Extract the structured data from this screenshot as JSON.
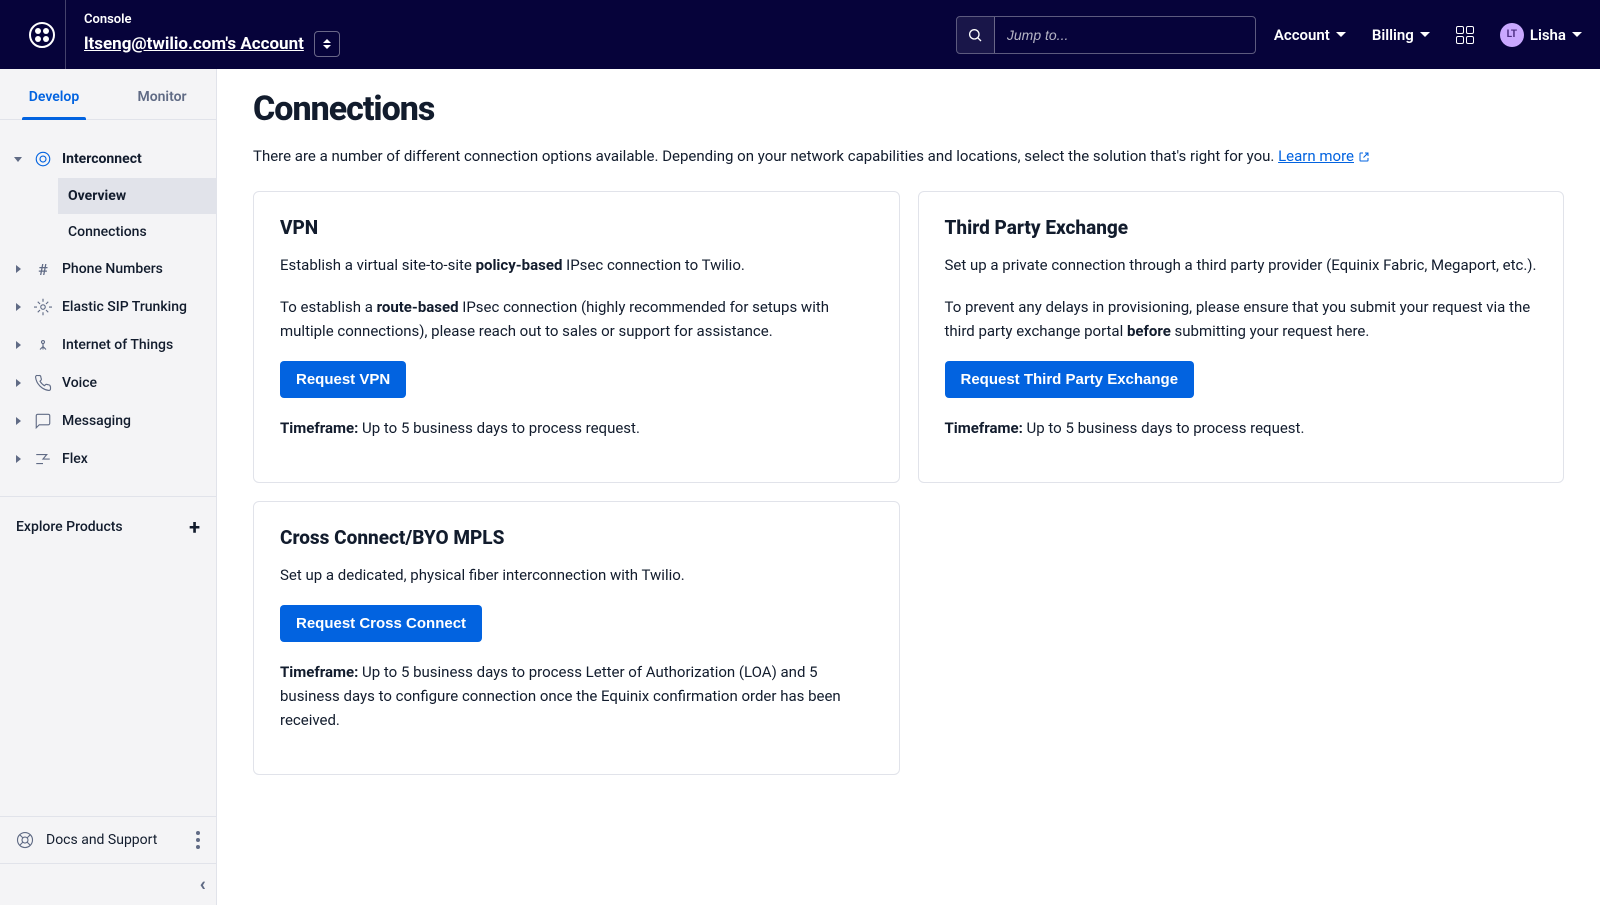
{
  "header": {
    "console_label": "Console",
    "account_name": "ltseng@twilio.com's Account",
    "search_placeholder": "Jump to...",
    "nav": {
      "account": "Account",
      "billing": "Billing",
      "user_initials": "LT",
      "user_name": "Lisha"
    }
  },
  "sidebar": {
    "tabs": {
      "develop": "Develop",
      "monitor": "Monitor"
    },
    "interconnect": {
      "label": "Interconnect",
      "children": {
        "overview": "Overview",
        "connections": "Connections"
      }
    },
    "items": [
      {
        "label": "Phone Numbers"
      },
      {
        "label": "Elastic SIP Trunking"
      },
      {
        "label": "Internet of Things"
      },
      {
        "label": "Voice"
      },
      {
        "label": "Messaging"
      },
      {
        "label": "Flex"
      }
    ],
    "explore": "Explore Products",
    "docs": "Docs and Support"
  },
  "page": {
    "title": "Connections",
    "intro_text": "There are a number of different connection options available. Depending on your network capabilities and locations, select the solution that's right for you. ",
    "learn_more": "Learn more"
  },
  "cards": {
    "vpn": {
      "title": "VPN",
      "p1a": "Establish a virtual site-to-site ",
      "p1b": "policy-based",
      "p1c": " IPsec connection to Twilio.",
      "p2a": "To establish a ",
      "p2b": "route-based",
      "p2c": " IPsec connection (highly recommended for setups with multiple connections), please reach out to sales or support for assistance.",
      "button": "Request VPN",
      "tf_label": "Timeframe:",
      "tf_text": " Up to 5 business days to process request."
    },
    "tpx": {
      "title": "Third Party Exchange",
      "p1": "Set up a private connection through a third party provider (Equinix Fabric, Megaport, etc.).",
      "p2a": "To prevent any delays in provisioning, please ensure that you submit your request via the third party exchange portal ",
      "p2b": "before",
      "p2c": " submitting your request here.",
      "button": "Request Third Party Exchange",
      "tf_label": "Timeframe:",
      "tf_text": " Up to 5 business days to process request."
    },
    "cc": {
      "title": "Cross Connect/BYO MPLS",
      "p1": "Set up a dedicated, physical fiber interconnection with Twilio.",
      "button": "Request Cross Connect",
      "tf_label": "Timeframe:",
      "tf_text": " Up to 5 business days to process Letter of Authorization (LOA) and 5 business days to configure connection once the Equinix confirmation order has been received."
    }
  }
}
